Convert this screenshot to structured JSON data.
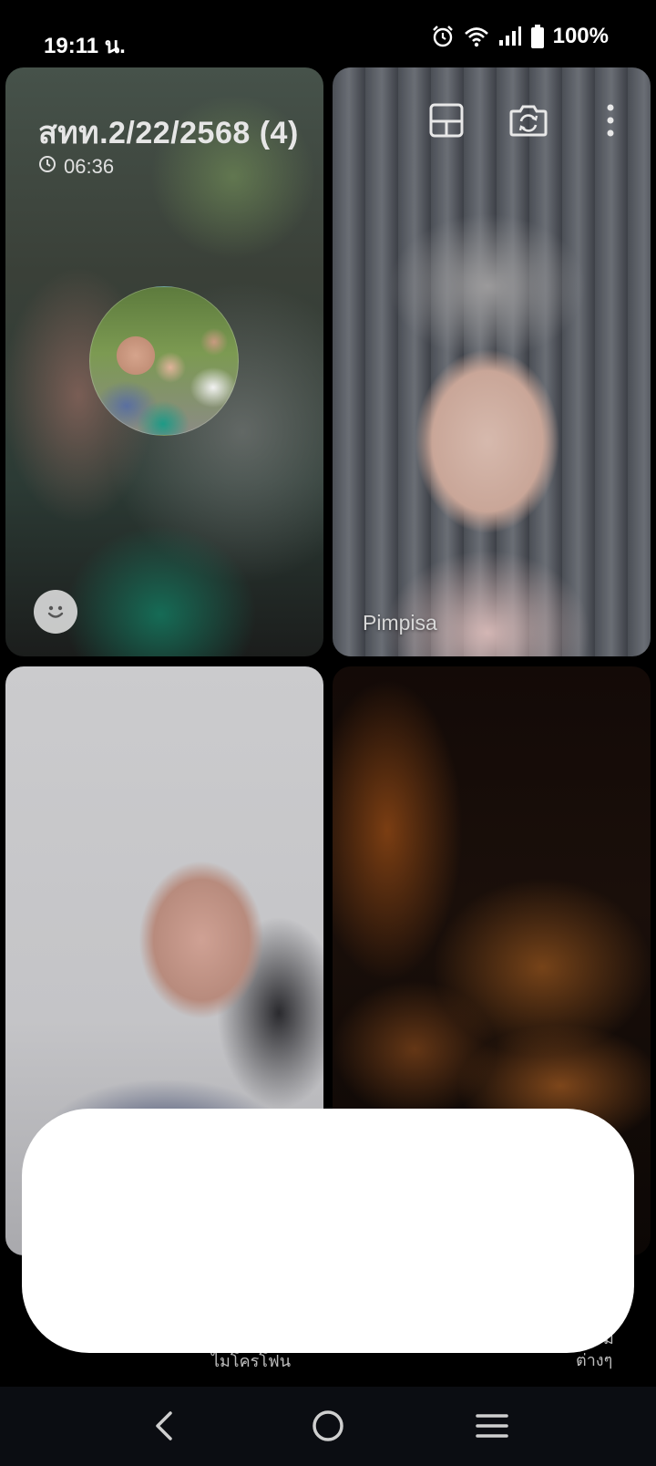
{
  "status_bar": {
    "time": "19:11 น.",
    "battery": "100%",
    "icons": [
      "alarm-icon",
      "wifi-icon",
      "signal-icon",
      "battery-icon"
    ]
  },
  "call": {
    "group_title": "สทท.2/22/2568 (4)",
    "timer": "06:36",
    "participant_name": "Pimpisa"
  },
  "controls": {
    "mic_label": "ไมโครโฟน",
    "more_label_line1": "ม",
    "more_label_line2": "ต่างๆ"
  },
  "colors": {
    "overlay": "#ffffff",
    "nav_background": "#0b0d12",
    "background": "#000000"
  }
}
